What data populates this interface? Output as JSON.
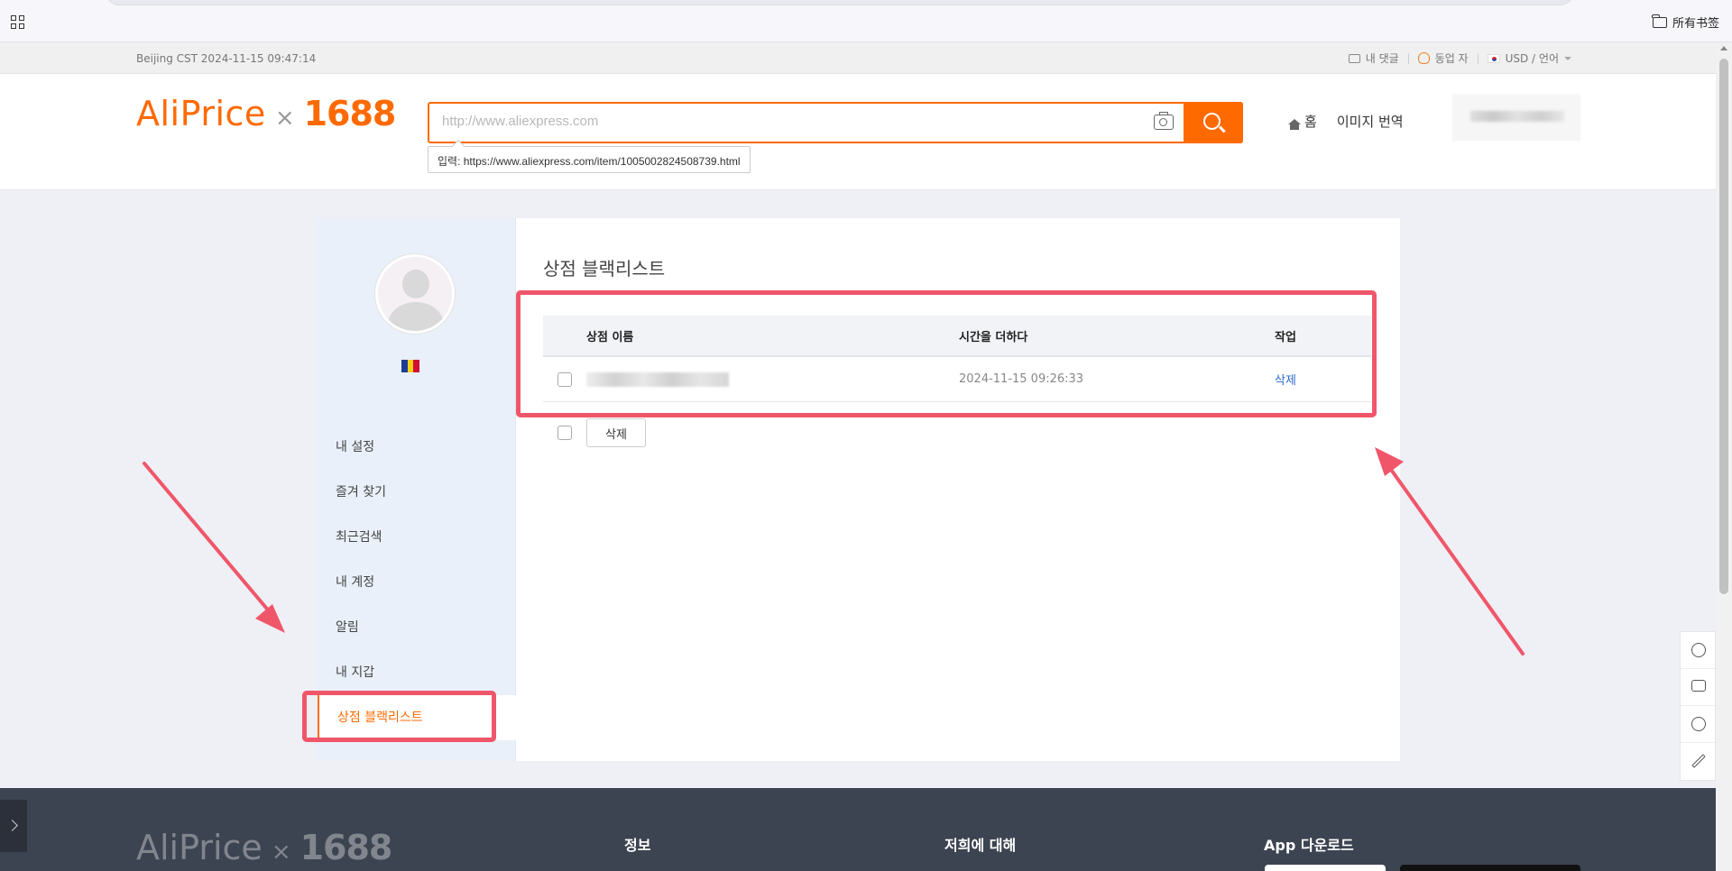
{
  "bookmarks": {
    "all_label": "所有书签"
  },
  "topbar": {
    "time": "Beijing CST  2024-11-15 09:47:14",
    "comments": "내 댓글",
    "partner": "동업 자",
    "currency": "USD / 언어"
  },
  "header": {
    "logo_left": "AliPrice",
    "logo_x": "×",
    "logo_right": "1688",
    "search_placeholder": "http://www.aliexpress.com",
    "tip": "입력:  https://www.aliexpress.com/item/1005002824508739.html",
    "nav_home": "홈",
    "nav_image_translate": "이미지 번역"
  },
  "sidebar": {
    "items": [
      {
        "label": "내 설정"
      },
      {
        "label": "즐겨 찾기"
      },
      {
        "label": "최근검색"
      },
      {
        "label": "내 계정"
      },
      {
        "label": "알림"
      },
      {
        "label": "내 지갑"
      },
      {
        "label": "상점 블랙리스트"
      }
    ],
    "active_index": 6
  },
  "main": {
    "title": "상점 블랙리스트",
    "columns": [
      "상점 이름",
      "시간을 더하다",
      "작업"
    ],
    "rows": [
      {
        "time": "2024-11-15 09:26:33",
        "action": "삭제"
      }
    ],
    "bulk_delete": "삭제"
  },
  "footer": {
    "logo_left": "AliPrice",
    "logo_x": "×",
    "logo_right": "1688",
    "col_info": "정보",
    "col_about": "저희에 대해",
    "col_app": "App 다운로드"
  },
  "colors": {
    "brand": "#ff6a00",
    "highlight": "#f0566a",
    "link": "#2a6ad4",
    "footer_bg": "#3d4451"
  },
  "icons": [
    "apps-grid-icon",
    "folder-icon",
    "comment-icon",
    "money-bag-icon",
    "korea-flag-icon",
    "camera-icon",
    "search-icon",
    "home-icon",
    "history-icon",
    "chat-icon",
    "smile-icon",
    "edit-icon",
    "andorra-flag-icon"
  ]
}
